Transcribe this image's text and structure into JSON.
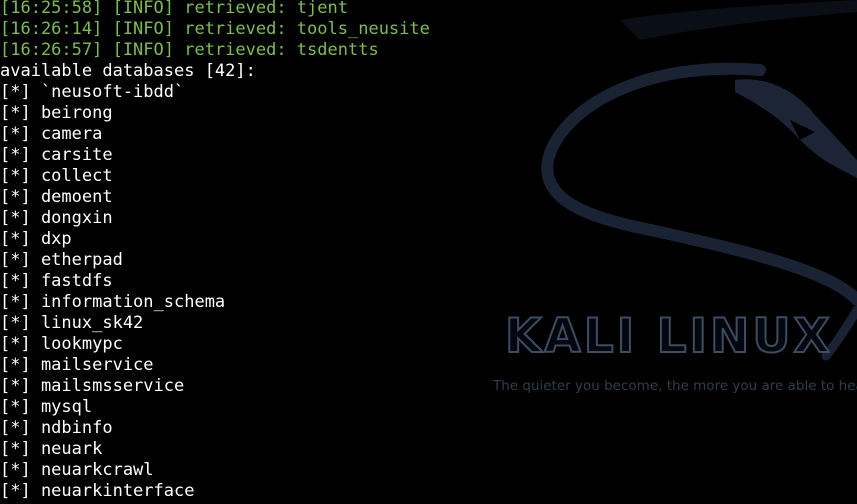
{
  "wallpaper": {
    "logo_text": "KALI LINUX",
    "tagline": "The quieter you become, the more you are able to hear.",
    "icon": "kali-dragon-icon"
  },
  "colors": {
    "background": "#000000",
    "log_green": "#79c142",
    "output_text": "#ffffff",
    "logo_outline": "#3c4c63",
    "dragon": "#1a2333"
  },
  "terminal": {
    "log_lines": [
      "[16:25:58] [INFO] retrieved: tjent",
      "[16:26:14] [INFO] retrieved: tools_neusite",
      "[16:26:57] [INFO] retrieved: tsdentts"
    ],
    "header": "available databases [42]:",
    "databases": [
      "[*] `neusoft-ibdd`",
      "[*] beirong",
      "[*] camera",
      "[*] carsite",
      "[*] collect",
      "[*] demoent",
      "[*] dongxin",
      "[*] dxp",
      "[*] etherpad",
      "[*] fastdfs",
      "[*] information_schema",
      "[*] linux_sk42",
      "[*] lookmypc",
      "[*] mailservice",
      "[*] mailsmsservice",
      "[*] mysql",
      "[*] ndbinfo",
      "[*] neuark",
      "[*] neuarkcrawl",
      "[*] neuarkinterface"
    ]
  }
}
